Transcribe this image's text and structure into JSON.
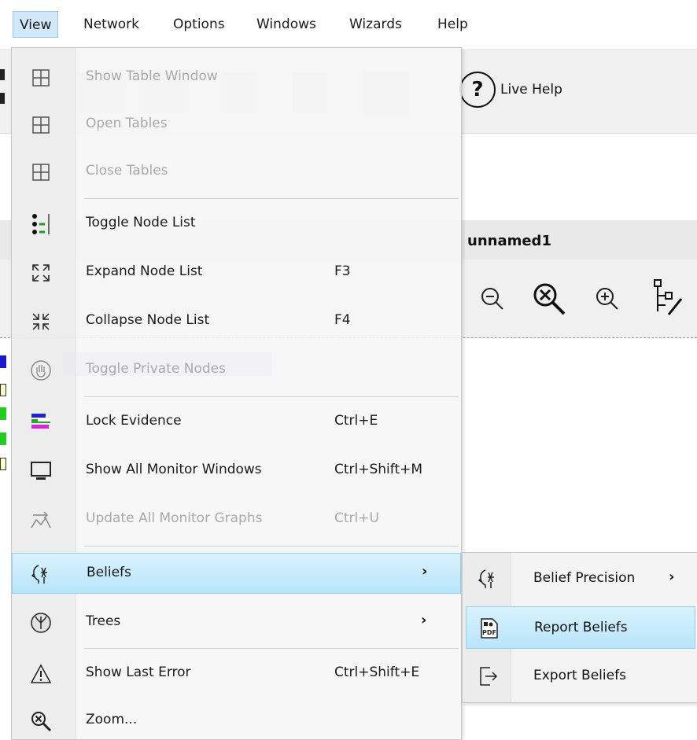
{
  "menubar": {
    "items": [
      "View",
      "Network",
      "Options",
      "Windows",
      "Wizards",
      "Help"
    ]
  },
  "toolbar": {
    "live_help_label": "Live Help"
  },
  "network": {
    "title": "unnamed1"
  },
  "view_menu": {
    "items": [
      {
        "label": "Show Table Window",
        "shortcut": "",
        "enabled": false,
        "icon": "table-icon"
      },
      {
        "label": "Open Tables",
        "shortcut": "",
        "enabled": false,
        "icon": "table-icon"
      },
      {
        "label": "Close Tables",
        "shortcut": "",
        "enabled": false,
        "icon": "table-icon"
      },
      {
        "label": "Toggle Node List",
        "shortcut": "",
        "enabled": true,
        "icon": "node-list-icon"
      },
      {
        "label": "Expand Node List",
        "shortcut": "F3",
        "enabled": true,
        "icon": "expand-icon"
      },
      {
        "label": "Collapse Node List",
        "shortcut": "F4",
        "enabled": true,
        "icon": "collapse-icon"
      },
      {
        "label": "Toggle Private Nodes",
        "shortcut": "",
        "enabled": false,
        "icon": "hand-icon"
      },
      {
        "label": "Lock Evidence",
        "shortcut": "Ctrl+E",
        "enabled": true,
        "icon": "lock-evidence-icon"
      },
      {
        "label": "Show All Monitor Windows",
        "shortcut": "Ctrl+Shift+M",
        "enabled": true,
        "icon": "monitor-icon"
      },
      {
        "label": "Update All Monitor Graphs",
        "shortcut": "Ctrl+U",
        "enabled": false,
        "icon": "update-graphs-icon"
      },
      {
        "label": "Beliefs",
        "shortcut": "",
        "enabled": true,
        "icon": "beliefs-icon",
        "submenu": true
      },
      {
        "label": "Trees",
        "shortcut": "",
        "enabled": true,
        "icon": "tree-icon",
        "submenu": true
      },
      {
        "label": "Show Last Error",
        "shortcut": "Ctrl+Shift+E",
        "enabled": true,
        "icon": "warning-icon"
      },
      {
        "label": "Zoom...",
        "shortcut": "",
        "enabled": true,
        "icon": "zoom-icon"
      }
    ]
  },
  "beliefs_submenu": {
    "items": [
      {
        "label": "Belief Precision",
        "icon": "beliefs-icon",
        "submenu": true
      },
      {
        "label": "Report Beliefs",
        "icon": "pdf-report-icon"
      },
      {
        "label": "Export Beliefs",
        "icon": "export-icon"
      }
    ]
  },
  "colors": {
    "highlight": "#b8e5fa",
    "disabled_text": "#a9a9a9",
    "menu_bg": "#f6f6f6"
  }
}
